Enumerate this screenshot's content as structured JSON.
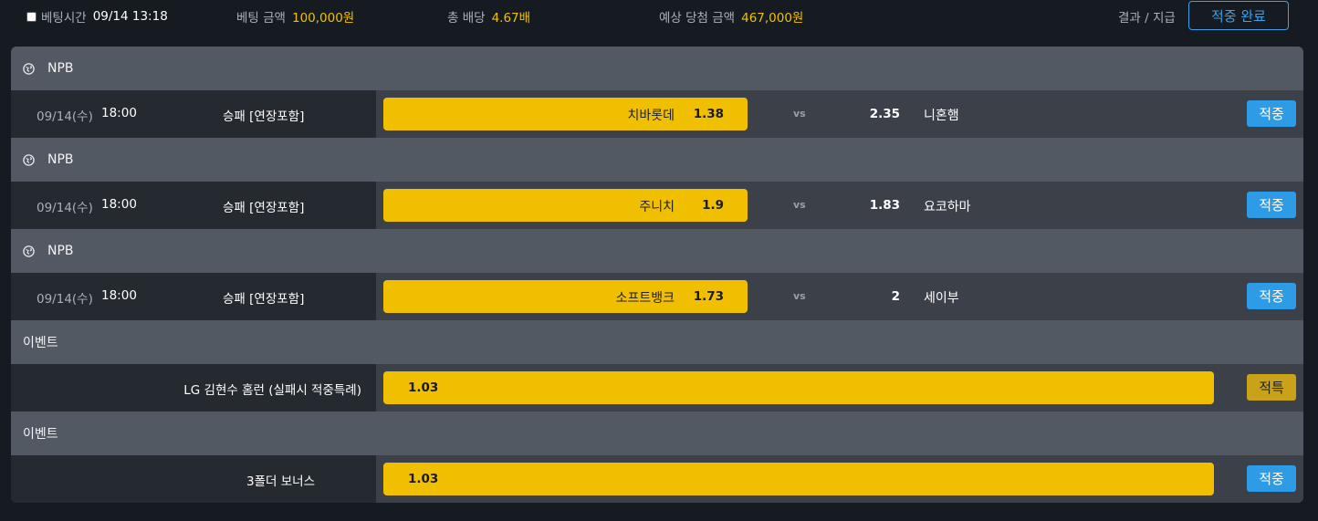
{
  "summary": {
    "bet_time_label": "베팅시간",
    "bet_time_value": "09/14 13:18",
    "bet_amount_label": "베팅 금액",
    "bet_amount_value": "100,000원",
    "total_odds_label": "총 배당",
    "total_odds_value": "4.67배",
    "expected_win_label": "예상 당첨 금액",
    "expected_win_value": "467,000원",
    "result_pay_label": "결과 / 지급",
    "result_button_label": "적중 완료"
  },
  "groups": [
    {
      "header": "NPB",
      "date": "09/14(수)",
      "time": "18:00",
      "market": "승패 [연장포함]",
      "home_team": "치바롯데",
      "home_odds": "1.38",
      "vs": "vs",
      "away_odds": "2.35",
      "away_team": "니혼햄",
      "status": "적중"
    },
    {
      "header": "NPB",
      "date": "09/14(수)",
      "time": "18:00",
      "market": "승패 [연장포함]",
      "home_team": "주니치",
      "home_odds": "1.9",
      "vs": "vs",
      "away_odds": "1.83",
      "away_team": "요코하마",
      "status": "적중"
    },
    {
      "header": "NPB",
      "date": "09/14(수)",
      "time": "18:00",
      "market": "승패 [연장포함]",
      "home_team": "소프트뱅크",
      "home_odds": "1.73",
      "vs": "vs",
      "away_odds": "2",
      "away_team": "세이부",
      "status": "적중"
    },
    {
      "header": "이벤트",
      "event_name": "LG 김현수 홈런 (실패시 적중특례)",
      "odds": "1.03",
      "status": "적특"
    },
    {
      "header": "이벤트",
      "event_name": "3폴더 보너스",
      "odds": "1.03",
      "status": "적중"
    }
  ],
  "colors": {
    "accent_blue": "#2e9be6",
    "odds_yellow": "#f0c000",
    "special_gold": "#c9a21a"
  },
  "icons": {
    "league": "globe-icon",
    "checkbox": "checkbox-icon"
  }
}
